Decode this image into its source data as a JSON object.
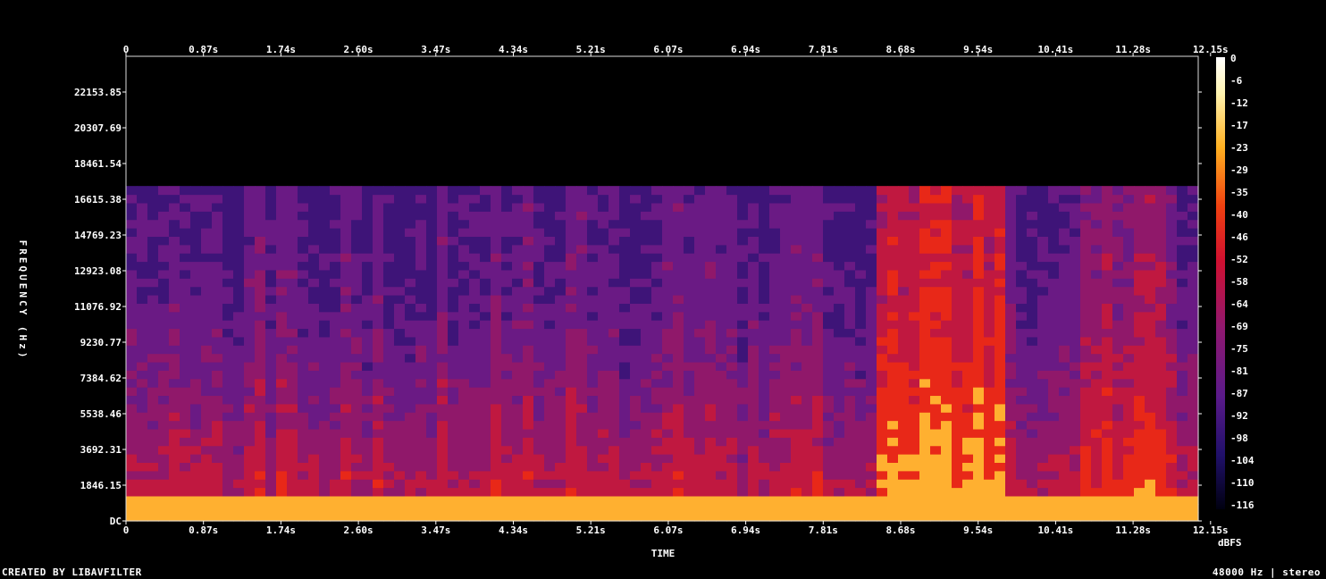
{
  "chart_data": {
    "type": "heatmap",
    "title": "",
    "xlabel": "TIME",
    "ylabel": "FREQUENCY (Hz)",
    "x_ticks": [
      "0",
      "0.87s",
      "1.74s",
      "2.60s",
      "3.47s",
      "4.34s",
      "5.21s",
      "6.07s",
      "6.94s",
      "7.81s",
      "8.68s",
      "9.54s",
      "10.41s",
      "11.28s",
      "12.15s"
    ],
    "y_ticks": [
      "DC",
      "1846.15",
      "3692.31",
      "5538.46",
      "7384.62",
      "9230.77",
      "11076.92",
      "12923.08",
      "14769.23",
      "16615.38",
      "18461.54",
      "20307.69",
      "22153.85"
    ],
    "colorbar_label": "dBFS",
    "colorbar_ticks": [
      "0",
      "-6",
      "-12",
      "-17",
      "-23",
      "-29",
      "-35",
      "-40",
      "-46",
      "-52",
      "-58",
      "-64",
      "-69",
      "-75",
      "-81",
      "-87",
      "-92",
      "-98",
      "-104",
      "-110",
      "-116"
    ],
    "xlim": [
      0,
      13.0
    ],
    "ylim": [
      0,
      24000
    ],
    "energy_cutoff_hz": 17300,
    "colors": {
      "low": "#0a0020",
      "mid": "#6a1a8a",
      "high": "#e02010",
      "peak": "#fff8c0"
    }
  },
  "footer": {
    "left": "CREATED BY LIBAVFILTER",
    "right": "48000 Hz | stereo"
  }
}
